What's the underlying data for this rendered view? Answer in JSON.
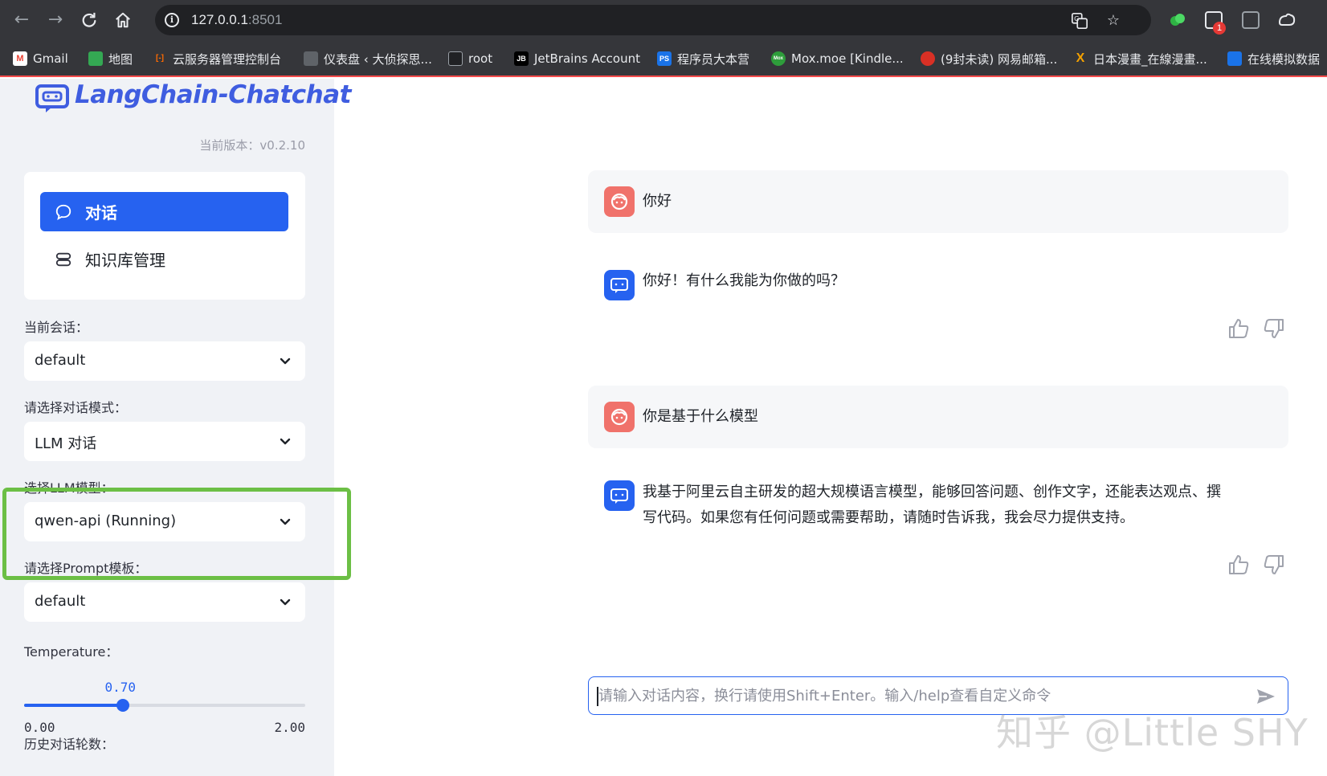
{
  "browser": {
    "url_host": "127.0.0.1",
    "url_port": ":8501",
    "bookmarks": [
      {
        "label": "Gmail",
        "icon": "gmail-icon",
        "icon_text": "M",
        "color": "#ea4335"
      },
      {
        "label": "地图",
        "icon": "maps-icon",
        "icon_text": "",
        "color": "#34a853"
      },
      {
        "label": "云服务器管理控制台",
        "icon": "aliyun-icon",
        "icon_text": "[-]",
        "color": "#ff6a00"
      },
      {
        "label": "仪表盘 ‹ 大侦探思...",
        "icon": "dashboard-icon",
        "icon_text": "",
        "color": "#5f6368"
      },
      {
        "label": "root",
        "icon": "github-icon",
        "icon_text": "",
        "color": "#202124"
      },
      {
        "label": "JetBrains Account",
        "icon": "jetbrains-icon",
        "icon_text": "JB",
        "color": "#000000"
      },
      {
        "label": "程序员大本营",
        "icon": "programmer-icon",
        "icon_text": "PS",
        "color": "#1a73e8"
      },
      {
        "label": "Mox.moe [Kindle...",
        "icon": "mox-icon",
        "icon_text": "Mox",
        "color": "#2e9d3b"
      },
      {
        "label": "(9封未读) 网易邮箱...",
        "icon": "netease-mail-icon",
        "icon_text": "",
        "color": "#d93025"
      },
      {
        "label": "日本漫畫_在線漫畫...",
        "icon": "manga-icon",
        "icon_text": "X",
        "color": "#f4a100"
      },
      {
        "label": "在线模拟数据",
        "icon": "mock-data-icon",
        "icon_text": "",
        "color": "#1a73e8"
      }
    ]
  },
  "sidebar": {
    "app_name": "LangChain-Chatchat",
    "version": "当前版本：v0.2.10",
    "menu": [
      {
        "label": "对话",
        "icon": "chat-bubble-icon",
        "active": true
      },
      {
        "label": "知识库管理",
        "icon": "database-icon",
        "active": false
      }
    ],
    "fields": [
      {
        "label": "当前会话：",
        "value": "default"
      },
      {
        "label": "请选择对话模式：",
        "value": "LLM 对话"
      },
      {
        "label": "选择LLM模型：",
        "value": "qwen-api (Running)"
      },
      {
        "label": "请选择Prompt模板：",
        "value": "default"
      }
    ],
    "temperature": {
      "label": "Temperature：",
      "value": "0.70",
      "min": "0.00",
      "max": "2.00",
      "fraction": 0.35
    },
    "history_label": "历史对话轮数："
  },
  "chat": {
    "messages": [
      {
        "role": "user",
        "text": "你好"
      },
      {
        "role": "assistant",
        "text": "你好！有什么我能为你做的吗？"
      },
      {
        "role": "user",
        "text": "你是基于什么模型"
      },
      {
        "role": "assistant",
        "text_line1": "我基于阿里云自主研发的超大规模语言模型，能够回答问题、创作文字，还能表达观点、撰",
        "text_line2": "写代码。如果您有任何问题或需要帮助，请随时告诉我，我会尽力提供支持。"
      }
    ],
    "input_placeholder": "请输入对话内容，换行请使用Shift+Enter。输入/help查看自定义命令"
  },
  "watermark": "知乎 @Little SHY",
  "colors": {
    "accent": "#2662f0",
    "user_avatar": "#f0726b",
    "highlight_border": "#6cbf45"
  }
}
